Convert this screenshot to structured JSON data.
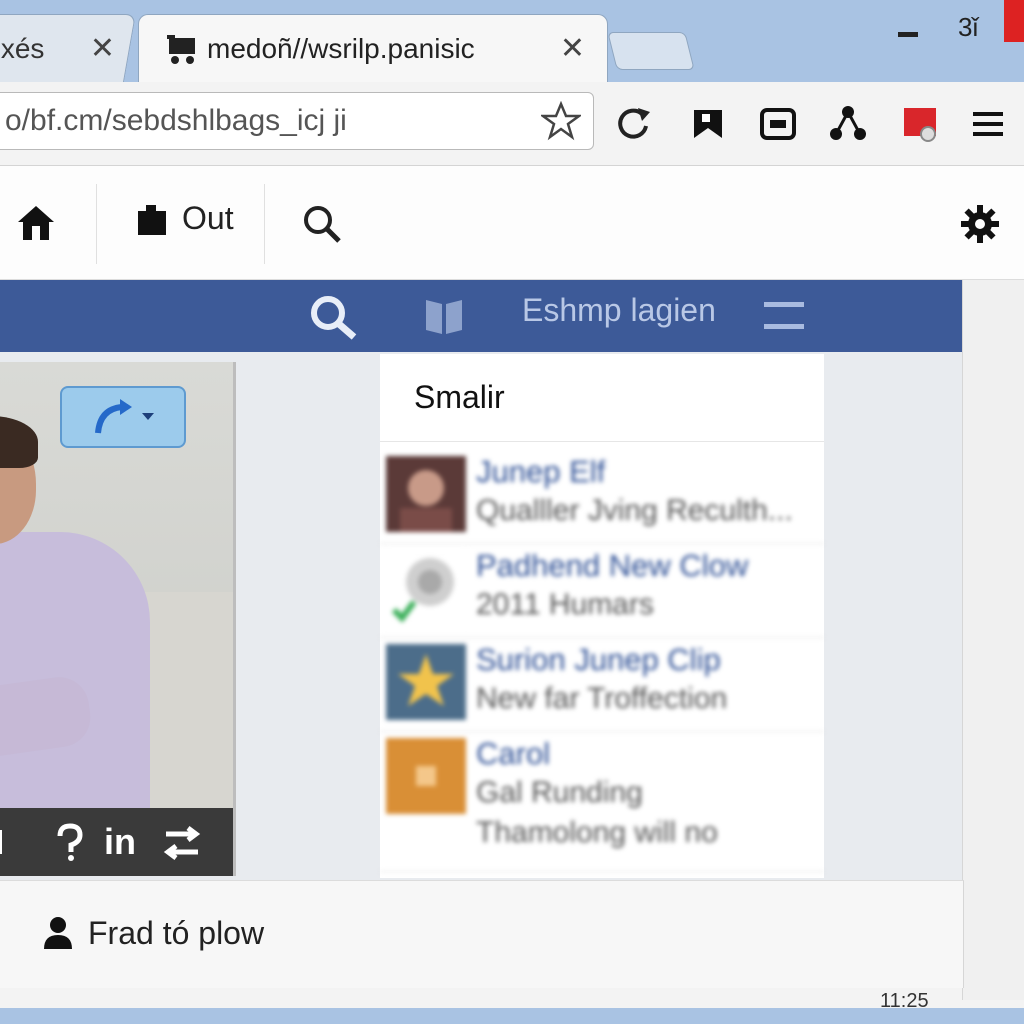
{
  "browser": {
    "tabs": [
      {
        "label": "xés",
        "active": false
      },
      {
        "label": "medoñ//wsrilp.panisic",
        "active": true
      }
    ],
    "close_glyph": "✕",
    "window_label": "3ǐ",
    "address": "o/bf.cm/sebdshlbags_icj ji"
  },
  "site_nav": {
    "out_label": "Out"
  },
  "fb": {
    "bar_title": "Eshmp lagien",
    "feed_heading": "Smalir",
    "items": [
      {
        "title": "Junep Elf",
        "sub": "Qualller Jving Reculth...",
        "thumb": "photo"
      },
      {
        "title": "Padhend New Clow",
        "sub": "2011 Humars",
        "thumb": "badge"
      },
      {
        "title": "Surion Junep Clip",
        "sub": "New far Troffection",
        "thumb": "star"
      },
      {
        "title": "Carol",
        "sub": "Gal Runding",
        "sub2": "Thamolong will no",
        "thumb": "orange"
      }
    ],
    "photo_footer": "in",
    "bottom_text": "Frad tó plow"
  },
  "status": {
    "clock": "11:25"
  },
  "colors": {
    "fb_blue": "#3d5a98",
    "tabstrip": "#a9c3e3",
    "link": "#2d4f95"
  }
}
